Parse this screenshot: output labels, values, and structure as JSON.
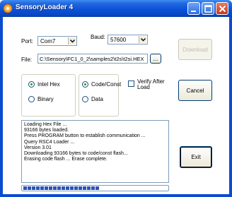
{
  "window": {
    "title": "SensoryLoader 4"
  },
  "port": {
    "label": "Port:",
    "value": "Com7"
  },
  "baud": {
    "label": "Baud:",
    "value": "57600"
  },
  "file": {
    "label": "File:",
    "value": "C:\\Sensory\\FC1_0_2\\samples2\\t2s\\t2si.HEX",
    "browse_label": "..."
  },
  "buttons": {
    "download": "Download",
    "cancel": "Cancel",
    "exit": "Exit"
  },
  "format_options": [
    {
      "label": "Intel Hex",
      "checked": true
    },
    {
      "label": "Binary",
      "checked": false
    }
  ],
  "target_options": [
    {
      "label": "Code/Const",
      "checked": true
    },
    {
      "label": "Data",
      "checked": false
    }
  ],
  "verify": {
    "label_line1": "Verify After",
    "label_line2": "Load",
    "checked": false
  },
  "log_lines": [
    "Loading Hex File ...",
    "93166 bytes loaded.",
    "Press PROGRAM button to establish communication ...",
    "Query RSC4 Loader ...",
    "Version 3.01",
    "Downloading 93166 bytes to code/const flash...",
    "Erasing code flash ... Erase complete."
  ],
  "progress": {
    "segments_filled": 18,
    "fraction": 0.5
  },
  "colors": {
    "titlebar": "#0a52d9",
    "progress": "#2c52b8",
    "radio_dot": "#21a121"
  }
}
